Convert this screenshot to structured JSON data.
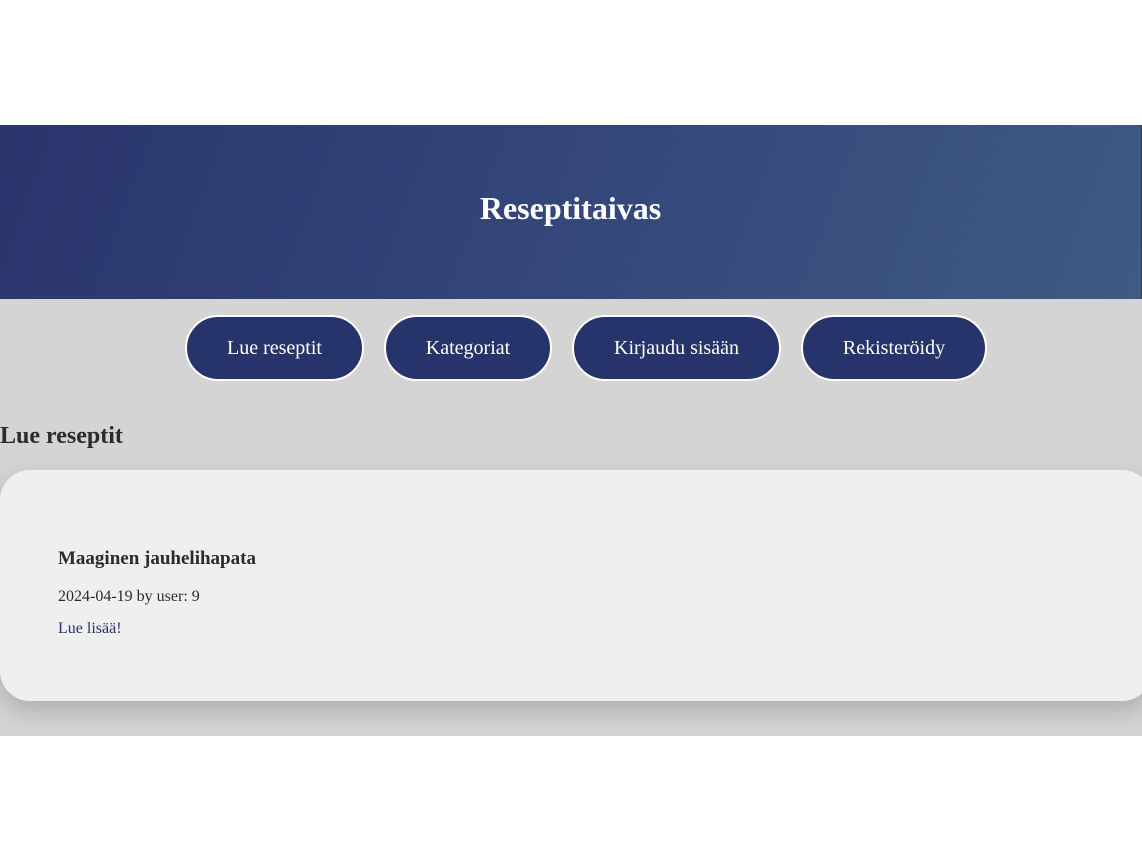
{
  "header": {
    "title": "Reseptitaivas"
  },
  "nav": {
    "items": [
      {
        "label": "Lue reseptit"
      },
      {
        "label": "Kategoriat"
      },
      {
        "label": "Kirjaudu sisään"
      },
      {
        "label": "Rekisteröidy"
      }
    ]
  },
  "main": {
    "heading": "Lue reseptit",
    "recipes": [
      {
        "title": "Maaginen jauhelihapata",
        "meta": "2024-04-19 by user: 9",
        "link_label": "Lue lisää!"
      }
    ]
  },
  "colors": {
    "header_gradient_start": "#2a356c",
    "header_gradient_end": "#3f5a84",
    "button_bg": "#27336b",
    "content_bg": "#d4d4d4",
    "card_bg": "#efefef"
  }
}
